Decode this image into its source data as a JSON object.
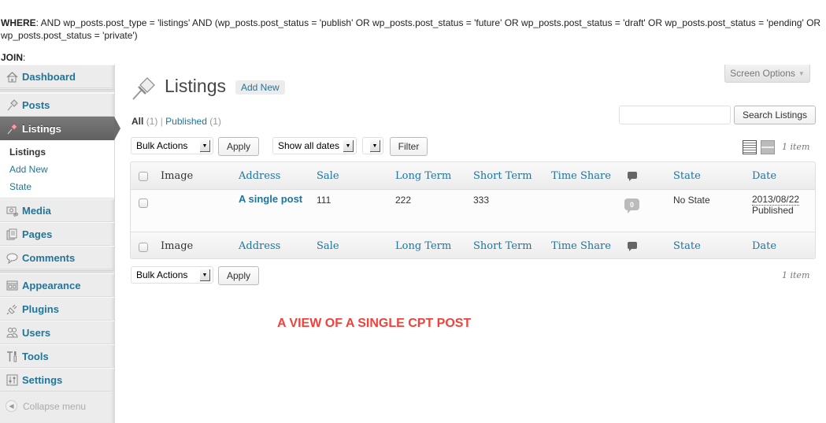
{
  "debug": {
    "where_label": "WHERE",
    "where_text": ": AND wp_posts.post_type = 'listings' AND (wp_posts.post_status = 'publish' OR wp_posts.post_status = 'future' OR wp_posts.post_status = 'draft' OR wp_posts.post_status = 'pending' OR wp_posts.post_status = 'private')",
    "join_label": "JOIN",
    "join_text": ":"
  },
  "sidebar": {
    "items": [
      {
        "label": "Dashboard",
        "icon": "home-icon"
      },
      {
        "label": "Posts",
        "icon": "pushpin-icon"
      },
      {
        "label": "Listings",
        "icon": "pushpin-icon",
        "active": true
      },
      {
        "label": "Media",
        "icon": "media-icon"
      },
      {
        "label": "Pages",
        "icon": "pages-icon"
      },
      {
        "label": "Comments",
        "icon": "comment-bubble-icon"
      },
      {
        "label": "Appearance",
        "icon": "appearance-icon"
      },
      {
        "label": "Plugins",
        "icon": "plug-icon"
      },
      {
        "label": "Users",
        "icon": "users-icon"
      },
      {
        "label": "Tools",
        "icon": "tools-icon"
      },
      {
        "label": "Settings",
        "icon": "settings-icon"
      }
    ],
    "submenu": [
      {
        "label": "Listings",
        "current": true
      },
      {
        "label": "Add New"
      },
      {
        "label": "State"
      }
    ],
    "collapse_label": "Collapse menu"
  },
  "header": {
    "title": "Listings",
    "add_new_label": "Add New",
    "screen_options_label": "Screen Options"
  },
  "filters": {
    "all_label": "All",
    "all_count": "(1)",
    "separator": "|",
    "published_label": "Published",
    "published_count": "(1)"
  },
  "search": {
    "value": "",
    "button_label": "Search Listings"
  },
  "tablenav_top": {
    "bulk_actions": "Bulk Actions",
    "apply_label": "Apply",
    "dates_select": "Show all dates",
    "third_select": "",
    "filter_label": "Filter",
    "items_count": "1 item"
  },
  "table": {
    "columns": [
      "Image",
      "Address",
      "Sale",
      "Long Term",
      "Short Term",
      "Time Share",
      "",
      "State",
      "Date"
    ],
    "rows": [
      {
        "image": "",
        "address": "A single post",
        "sale": "111",
        "long_term": "222",
        "short_term": "333",
        "time_share": "",
        "comments": "0",
        "state": "No State",
        "date": "2013/08/22",
        "status": "Published"
      }
    ]
  },
  "tablenav_bottom": {
    "bulk_actions": "Bulk Actions",
    "apply_label": "Apply",
    "items_count": "1 item"
  },
  "caption": {
    "text": "A VIEW OF A SINGLE CPT POST",
    "color": "#f2413a"
  },
  "colors": {
    "link": "#21759b",
    "active_menu": "#6c6c6c"
  }
}
